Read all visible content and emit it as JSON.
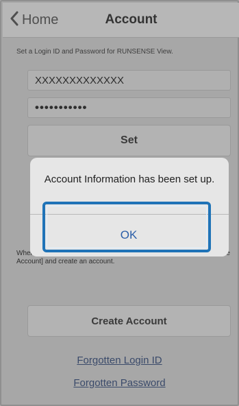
{
  "navbar": {
    "back_label": "Home",
    "title": "Account"
  },
  "form": {
    "hint": "Set a Login ID and Password for RUNSENSE View.",
    "login_id_value": "XXXXXXXXXXXXX",
    "password_value": "•••••••••••",
    "set_label": "Set"
  },
  "note": {
    "text_left": "When",
    "text_right": "eate",
    "line2": "Account] and create an account."
  },
  "create_label": "Create Account",
  "links": {
    "forgot_login": "Forgotten Login ID",
    "forgot_password": "Forgotten Password"
  },
  "alert": {
    "message": "Account Information has been set up.",
    "ok_label": "OK"
  },
  "colors": {
    "highlight": "#1f73b7",
    "ok_text": "#2a5ea8"
  }
}
